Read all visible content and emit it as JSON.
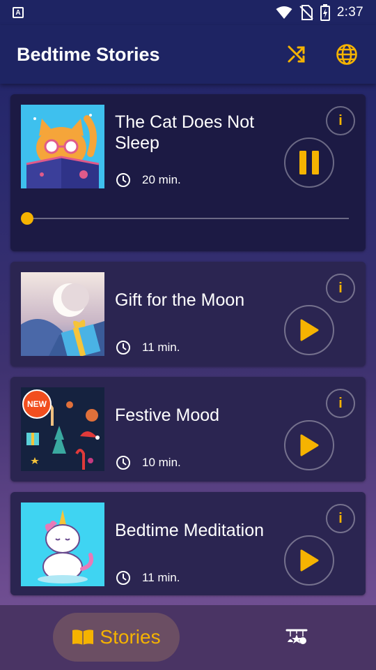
{
  "status_bar": {
    "time": "2:37",
    "app_icon_letter": "A"
  },
  "app_bar": {
    "title": "Bedtime Stories",
    "icons": [
      "shuffle-icon",
      "globe-icon"
    ],
    "accent_color": "#f5b301"
  },
  "stories": [
    {
      "title": "The Cat Does Not Sleep",
      "duration": "20 min.",
      "state": "playing",
      "info_label": "i",
      "progress": 0.0
    },
    {
      "title": "Gift for the Moon",
      "duration": "11 min.",
      "state": "paused",
      "info_label": "i"
    },
    {
      "title": "Festive Mood",
      "duration": "10 min.",
      "state": "paused",
      "info_label": "i",
      "badge": "NEW"
    },
    {
      "title": "Bedtime Meditation",
      "duration": "11 min.",
      "state": "paused",
      "info_label": "i"
    }
  ],
  "bottom_nav": {
    "stories_label": "Stories",
    "icons": [
      "book-icon",
      "mobile-toy-icon"
    ]
  }
}
